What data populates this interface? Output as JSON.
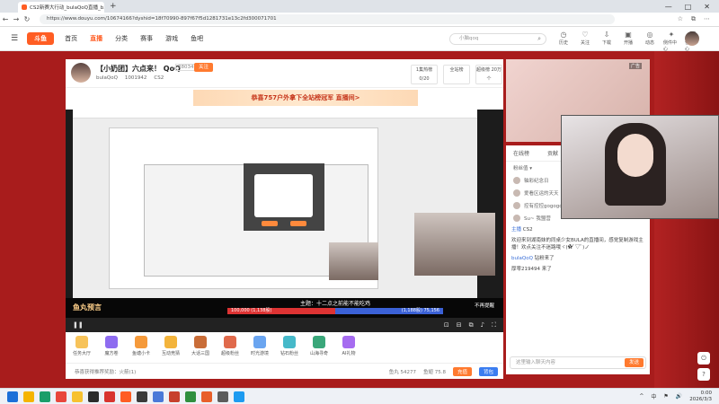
{
  "browser": {
    "tab_title": "CS2新赛大行动_bulaQoQ直播_b...",
    "tab_close": "×",
    "new_tab": "+",
    "window_controls": [
      "—",
      "□",
      "✕"
    ],
    "url": "https://www.douyu.com/10674166?dyshid=18f70990-897f67f5d1281731e13c2fd300071701",
    "nav": {
      "back": "←",
      "forward": "→",
      "reload": "↻"
    }
  },
  "site": {
    "logo": "斗鱼",
    "nav": [
      "首页",
      "直播",
      "分类",
      "赛事",
      "游戏",
      "鱼吧"
    ],
    "search_placeholder": "小脑qoq",
    "tools": [
      "历史",
      "关注",
      "下载",
      "开播",
      "动态",
      "侧件中心",
      "任务中心"
    ]
  },
  "channel": {
    "title": "【小奶团】六点来！ QoQ",
    "badge": "28034",
    "follow": "关注",
    "streamer": "bulaQoQ",
    "followers": "1001942",
    "game": "CS2",
    "rank_labels": [
      "1集热榜\n0/20",
      "全站榜",
      "超级榜\n20万个"
    ],
    "banner": "恭喜757户外拿下全站榜冠军 直播间>"
  },
  "player": {
    "overlay_brand": "鱼丸预言",
    "vs_title": "主题：十二点之前能不能吃鸡",
    "vs_left": "100,000 (1,138股)",
    "vs_right": "(1,188股) 75,156",
    "no_danmu": "不再提醒",
    "controls_left": "❚❚",
    "controls_right": [
      "⊡",
      "⊟",
      "⧉",
      "♪",
      "⛶"
    ]
  },
  "gifts": [
    {
      "label": "任务大厅",
      "color": "#f7c35a"
    },
    {
      "label": "魔方卷",
      "color": "#8e6cf0"
    },
    {
      "label": "鱼塘小卡",
      "color": "#f59a3b"
    },
    {
      "label": "互动竞猜",
      "color": "#f3b43c"
    },
    {
      "label": "大话三国",
      "color": "#c96d38"
    },
    {
      "label": "超级粉丝",
      "color": "#e06a4c"
    },
    {
      "label": "时光游境",
      "color": "#6aa5f0"
    },
    {
      "label": "钻石粉丝",
      "color": "#46b9c9"
    },
    {
      "label": "山海寻奇",
      "color": "#3aa77a"
    },
    {
      "label": "AI礼物",
      "color": "#a66cf0"
    }
  ],
  "statusbar": {
    "left": "恭喜获得推荐奖励：火箭(1)",
    "fishball": "鱼丸 54277",
    "coins": "鱼翅 75.8",
    "charge": "充值",
    "backpack": "背包"
  },
  "sidebar": {
    "ad": "广告",
    "tabs": [
      "在线榜",
      "贡献"
    ],
    "rank_title": "粉丝值 ▾",
    "rank_rows": [
      "轴彩纪念日",
      "爱看区运的天天",
      "控有控控gogogo",
      "Su~ 我盟营"
    ],
    "messages": [
      {
        "name": "主播",
        "text": "CS2"
      },
      {
        "name": "",
        "text": "欢迎来到湖南妹的同桌少女BULA的直播间，感觉复制游戏主播！欢点关注不迷路哦ヾ(✿ﾟ▽ﾟ)ノ"
      },
      {
        "name": "bulaQoQ",
        "text": "钻粉来了"
      },
      {
        "name": "",
        "text": "厚零219494 来了"
      }
    ],
    "input_placeholder": "这里输入聊天内容",
    "send": "发送",
    "side_buttons": [
      "⏻",
      "?"
    ]
  },
  "taskbar": {
    "time": "0:00",
    "date": "2026/3/3",
    "tray": [
      "^",
      "中",
      "⚑",
      "🔊"
    ],
    "icons": [
      "#1b6fd8",
      "#f5b400",
      "#1a9e6a",
      "#e8463b",
      "#f7c12f",
      "#2b2b2b",
      "#d8342e",
      "#ff5d23",
      "#3a3a3a",
      "#4a79d8",
      "#c7402c",
      "#2f8f3e",
      "#e85f2a",
      "#5c5c5c",
      "#1d9bf0"
    ]
  }
}
